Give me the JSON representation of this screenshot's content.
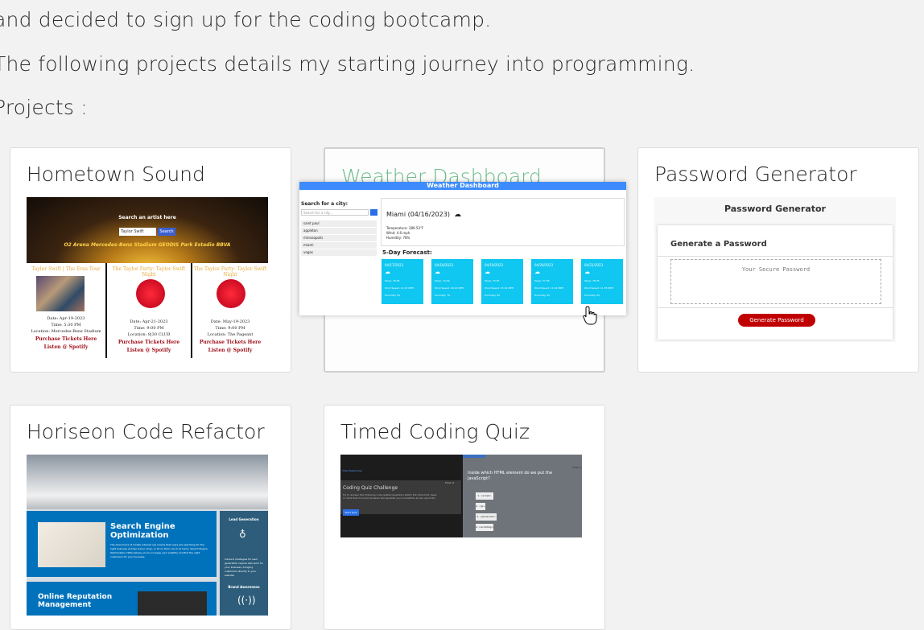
{
  "intro": {
    "line1": "and decided to sign up for the coding bootcamp.",
    "line2": "The following projects details my starting journey into programming.",
    "heading": "Projects :"
  },
  "projects": [
    {
      "title": "Hometown Sound",
      "thumb": {
        "search_label": "Search an artist here",
        "search_value": "Taylor Swift",
        "search_button": "Search",
        "venues_bar": "O2 Arena   Mercedes-Benz Stadium   GEODIS Park   Estadio BBVA",
        "events": [
          {
            "title": "Taylor Swift | The Eras Tour",
            "date": "Date: Apr-19-2023",
            "time": "Time: 5:30 PM",
            "location": "Location: Mercedes-Benz Stadium",
            "buy": "Purchase Tickets Here",
            "listen": "Listen @ Spotify"
          },
          {
            "title": "The Taylor Party: Taylor Swift Night",
            "date": "Date: Apr-21-2023",
            "time": "Time: 9:00 PM",
            "location": "Location: 8|30 CLUB",
            "buy": "Purchase Tickets Here",
            "listen": "Listen @ Spotify"
          },
          {
            "title": "The Taylor Party: Taylor Swift Night",
            "date": "Date: May-19-2023",
            "time": "Time: 9:00 PM",
            "location": "Location: The Pageant",
            "buy": "Purchase Tickets Here",
            "listen": "Listen @ Spotify"
          }
        ]
      }
    },
    {
      "title": "Weather Dashboard",
      "thumb": {
        "header": "Weather Dashboard",
        "search_label": "Search for a city:",
        "search_placeholder": "Search for a city...",
        "history": [
          "saint paul",
          "appleton",
          "minneapolis",
          "miami",
          "vegas"
        ],
        "city": "Miami (04/16/2023)",
        "temp": "Temperature: 289.53°F",
        "wind": "Wind: 4.6 mph",
        "humidity": "Humidity: 78%",
        "forecast_label": "5-Day Forecast:",
        "forecast": [
          {
            "date": "04/17/2023",
            "temp": "Temp: 76.65",
            "wind": "Wind Speed: 12.13 MPH",
            "humidity": "Humidity: 81"
          },
          {
            "date": "04/18/2023",
            "temp": "Temp: 74.49",
            "wind": "Wind Speed: 18.22 MPH",
            "humidity": "Humidity: 70"
          },
          {
            "date": "04/19/2023",
            "temp": "Temp: 75.87",
            "wind": "Wind Speed: 15.01 MPH",
            "humidity": "Humidity: 65"
          },
          {
            "date": "04/20/2023",
            "temp": "Temp: 77.38",
            "wind": "Wind Speed: 11.52 MPH",
            "humidity": "Humidity: 65"
          },
          {
            "date": "04/21/2023",
            "temp": "Temp: 78.35",
            "wind": "Wind Speed: 11.78 MPH",
            "humidity": "Humidity: 65"
          }
        ]
      }
    },
    {
      "title": "Password Generator",
      "thumb": {
        "header": "Password Generator",
        "card_title": "Generate a Password",
        "placeholder": "Your Secure Password",
        "button": "Generate Password"
      }
    },
    {
      "title": "Horiseon Code Refactor",
      "thumb": {
        "box1_title": "Search Engine Optimization",
        "box1_text": "The dominance of mobile internet use means that users are searching for the right business as they travel, shop, or sit on their couch at home. Search Engine Optimization (SEO) allows you to increase your visibility and find the right customers for your business.",
        "box2_title": "Online Reputation Management",
        "side1": "Lead Generation",
        "side_text": "Inbound strategies for lead generation require less work for your business, bringing customers directly to your website.",
        "side2": "Brand Awareness"
      }
    },
    {
      "title": "Timed Coding Quiz",
      "thumb": {
        "scores_link": "View Highscores",
        "timer": "Time: 0",
        "heading": "Coding Quiz Challenge",
        "text": "Try to answer the following code-related questions within the time limit. Keep in mind that incorrect answers will penalize your score/time by ten seconds!",
        "start": "Start Quiz",
        "question": "Inside which HTML element do we put the JavaScript?",
        "answers": [
          "1. <script>",
          "2. <js>",
          "3. <javascript>",
          "4. <scripting>"
        ]
      }
    }
  ],
  "colors": {
    "hover_title": "#6dbb8a",
    "weather_blue": "#3d8bfd",
    "forecast_cyan": "#0fc7f0",
    "password_red": "#c00000",
    "horiseon_blue": "#0072bb",
    "quiz_dark": "#1c1c1c",
    "quiz_gray": "#6f747b"
  }
}
